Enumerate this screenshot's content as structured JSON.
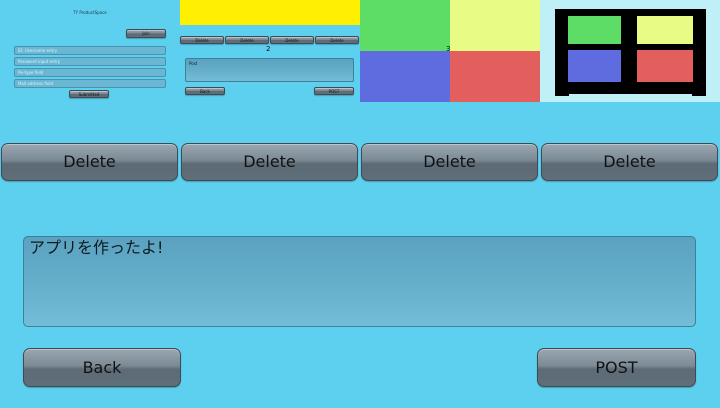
{
  "panels": {
    "p1": {
      "number": "1",
      "header": "TY ProductSpace",
      "top_button": "Join",
      "fields": [
        "ID: Username entry",
        "Password input entry",
        "Re-type field",
        "Mail address field"
      ],
      "submit": "Submitted"
    },
    "p2": {
      "number": "2",
      "delete_buttons": [
        "Delete",
        "Delete",
        "Delete",
        "Delete"
      ],
      "textarea_text": "Post",
      "back": "Back",
      "post": "POST"
    },
    "p3": {
      "number": "3"
    }
  },
  "colors": {
    "background": "#5dd0ef",
    "yellow": "#ffef00",
    "green": "#5ddd66",
    "light_yellow": "#e8fb85",
    "blue": "#5e6cdf",
    "red": "#e25f5e",
    "black": "#000000"
  },
  "delete_buttons": [
    "Delete",
    "Delete",
    "Delete",
    "Delete"
  ],
  "post_text": "アプリを作ったよ!",
  "back_label": "Back",
  "post_label": "POST"
}
